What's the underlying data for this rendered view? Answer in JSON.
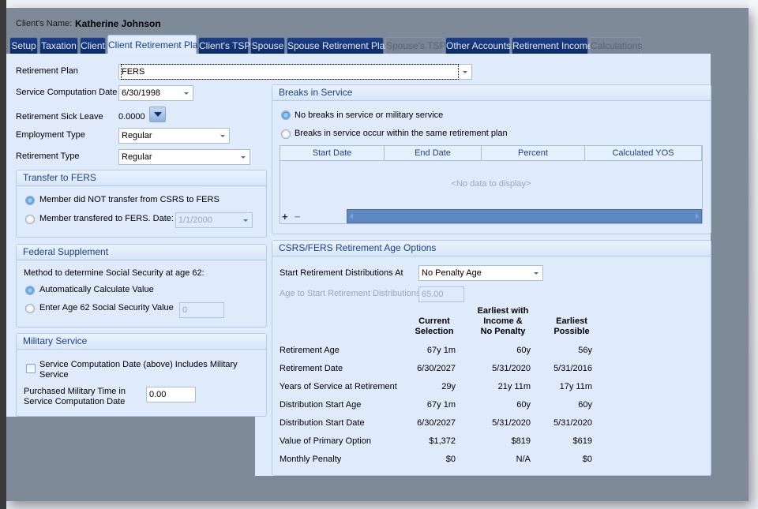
{
  "header": {
    "client_name_label": "Client's Name:",
    "client_name": "Katherine Johnson"
  },
  "tabs": [
    {
      "label": "Setup"
    },
    {
      "label": "Taxation"
    },
    {
      "label": "Client"
    },
    {
      "label": "Client Retirement Plan",
      "active": true
    },
    {
      "label": "Client's TSP"
    },
    {
      "label": "Spouse"
    },
    {
      "label": "Spouse Retirement Plan"
    },
    {
      "label": "Spouse's TSP",
      "disabled": true
    },
    {
      "label": "Other Accounts"
    },
    {
      "label": "Retirement Income"
    },
    {
      "label": "Calculations",
      "disabled": true
    }
  ],
  "form": {
    "retirement_plan_label": "Retirement Plan",
    "retirement_plan": "FERS",
    "scd_label": "Service Computation Date",
    "scd": "6/30/1998",
    "sick_leave_label": "Retirement Sick Leave",
    "sick_leave": "0.0000",
    "employment_type_label": "Employment Type",
    "employment_type": "Regular",
    "retirement_type_label": "Retirement Type",
    "retirement_type": "Regular"
  },
  "transfer": {
    "title": "Transfer to FERS",
    "opt1": "Member did NOT transfer from CSRS to FERS",
    "opt2": "Member transfered to FERS. Date:",
    "date": "1/1/2000"
  },
  "supplement": {
    "title": "Federal Supplement",
    "method_label": "Method to determine Social Security at age 62:",
    "opt1": "Automatically Calculate Value",
    "opt2": "Enter Age 62 Social Security Value",
    "value": "0"
  },
  "military": {
    "title": "Military Service",
    "checkbox_label_1": "Service Computation Date (above) Includes Military",
    "checkbox_label_2": "Service",
    "purchased_label_1": "Purchased Military Time in",
    "purchased_label_2": "Service Computation Date",
    "purchased": "0.00"
  },
  "breaks": {
    "title": "Breaks in Service",
    "opt1": "No breaks in service or military service",
    "opt2": "Breaks in service occur within the same retirement plan",
    "columns": [
      "Start Date",
      "End Date",
      "Percent",
      "Calculated YOS"
    ],
    "empty": "<No data to display>",
    "add": "+",
    "remove": "−"
  },
  "age_options": {
    "title": "CSRS/FERS Retirement Age Options",
    "start_label": "Start Retirement Distributions At",
    "start_value": "No Penalty Age",
    "age_label": "Age to Start Retirement Distributions",
    "age_value": "65.00",
    "columns": [
      [
        "Current",
        "Selection"
      ],
      [
        "Earliest with",
        "Income &",
        "No Penalty"
      ],
      [
        "Earliest",
        "Possible"
      ]
    ],
    "rows": [
      {
        "label": "Retirement Age",
        "values": [
          "67y 1m",
          "60y",
          "56y"
        ]
      },
      {
        "label": "Retirement Date",
        "values": [
          "6/30/2027",
          "5/31/2020",
          "5/31/2016"
        ]
      },
      {
        "label": "Years of Service at Retirement",
        "values": [
          "29y",
          "21y 11m",
          "17y 11m"
        ]
      },
      {
        "label": "Distribution Start Age",
        "values": [
          "67y 1m",
          "60y",
          "60y"
        ]
      },
      {
        "label": "Distribution Start Date",
        "values": [
          "6/30/2027",
          "5/31/2020",
          "5/31/2020"
        ]
      },
      {
        "label": "Value of Primary Option",
        "values": [
          "$1,372",
          "$819",
          "$619"
        ]
      },
      {
        "label": "Monthly Penalty",
        "values": [
          "$0",
          "N/A",
          "$0"
        ]
      }
    ]
  }
}
